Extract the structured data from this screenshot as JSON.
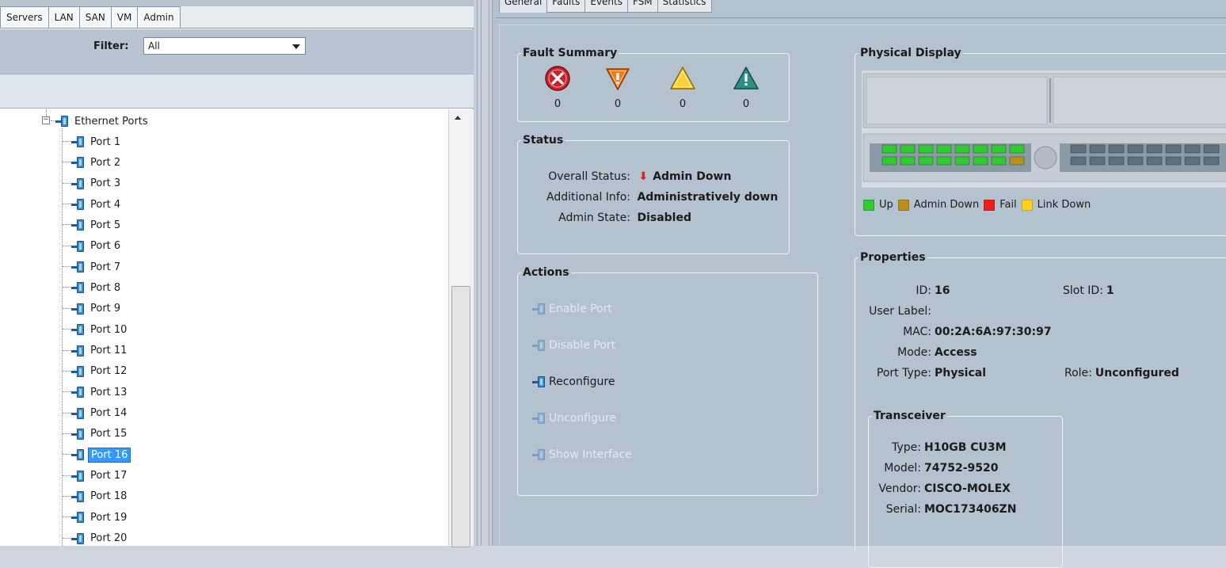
{
  "nav_tabs": [
    "Servers",
    "LAN",
    "SAN",
    "VM",
    "Admin"
  ],
  "filter": {
    "label": "Filter:",
    "value": "All"
  },
  "tree": {
    "root_label": "Ethernet Ports",
    "ports": [
      "Port 1",
      "Port 2",
      "Port 3",
      "Port 4",
      "Port 5",
      "Port 6",
      "Port 7",
      "Port 8",
      "Port 9",
      "Port 10",
      "Port 11",
      "Port 12",
      "Port 13",
      "Port 14",
      "Port 15",
      "Port 16",
      "Port 17",
      "Port 18",
      "Port 19",
      "Port 20"
    ],
    "selected": "Port 16"
  },
  "detail_tabs": [
    "General",
    "Faults",
    "Events",
    "FSM",
    "Statistics"
  ],
  "fault_summary": {
    "title": "Fault Summary",
    "critical": "0",
    "major": "0",
    "minor": "0",
    "warning": "0"
  },
  "status": {
    "title": "Status",
    "overall_label": "Overall Status:",
    "overall_value": "Admin Down",
    "info_label": "Additional Info:",
    "info_value": "Administratively down",
    "admin_label": "Admin State:",
    "admin_value": "Disabled"
  },
  "actions": {
    "title": "Actions",
    "enable": "Enable Port",
    "disable": "Disable Port",
    "reconfigure": "Reconfigure",
    "unconfigure": "Unconfigure",
    "show_interface": "Show Interface"
  },
  "physical_display": {
    "title": "Physical Display",
    "legend": [
      {
        "label": "Up",
        "color": "#2ecc2e"
      },
      {
        "label": "Admin Down",
        "color": "#b8901c"
      },
      {
        "label": "Fail",
        "color": "#e8201e"
      },
      {
        "label": "Link Down",
        "color": "#ffd21f"
      }
    ]
  },
  "properties": {
    "title": "Properties",
    "id_label": "ID:",
    "id_value": "16",
    "slot_label": "Slot ID:",
    "slot_value": "1",
    "user_label_label": "User Label:",
    "user_label_value": "",
    "mac_label": "MAC:",
    "mac_value": "00:2A:6A:97:30:97",
    "mode_label": "Mode:",
    "mode_value": "Access",
    "port_type_label": "Port Type:",
    "port_type_value": "Physical",
    "role_label": "Role:",
    "role_value": "Unconfigured"
  },
  "transceiver": {
    "title": "Transceiver",
    "type_label": "Type:",
    "type_value": "H10GB CU3M",
    "model_label": "Model:",
    "model_value": "74752-9520",
    "vendor_label": "Vendor:",
    "vendor_value": "CISCO-MOLEX",
    "serial_label": "Serial:",
    "serial_value": "MOC173406ZN"
  },
  "colors": {
    "accent": "#3399ff",
    "panel": "#b4c1cf"
  }
}
